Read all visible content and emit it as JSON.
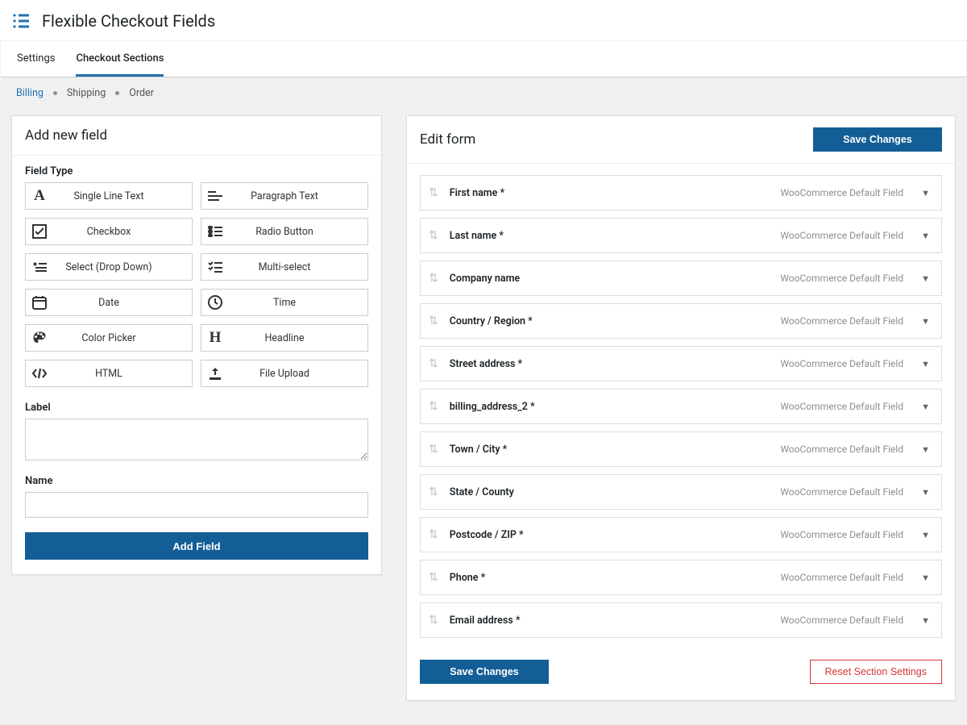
{
  "header": {
    "title": "Flexible Checkout Fields"
  },
  "tabs": {
    "settings": "Settings",
    "sections": "Checkout Sections"
  },
  "subnav": {
    "billing": "Billing",
    "shipping": "Shipping",
    "order": "Order"
  },
  "left": {
    "title": "Add new field",
    "field_type_label": "Field Type",
    "label_label": "Label",
    "name_label": "Name",
    "add_button": "Add Field",
    "types": {
      "text": "Single Line Text",
      "paragraph": "Paragraph Text",
      "checkbox": "Checkbox",
      "radio": "Radio Button",
      "select": "Select (Drop Down)",
      "multiselect": "Multi-select",
      "date": "Date",
      "time": "Time",
      "color": "Color Picker",
      "headline": "Headline",
      "html": "HTML",
      "file": "File Upload"
    }
  },
  "right": {
    "title": "Edit form",
    "save_button": "Save Changes",
    "reset_button": "Reset Section Settings",
    "default_meta": "WooCommerce Default Field",
    "fields": [
      {
        "label": "First name *"
      },
      {
        "label": "Last name *"
      },
      {
        "label": "Company name"
      },
      {
        "label": "Country / Region *"
      },
      {
        "label": "Street address *"
      },
      {
        "label": "billing_address_2 *"
      },
      {
        "label": "Town / City *"
      },
      {
        "label": "State / County"
      },
      {
        "label": "Postcode / ZIP *"
      },
      {
        "label": "Phone *"
      },
      {
        "label": "Email address *"
      }
    ]
  }
}
